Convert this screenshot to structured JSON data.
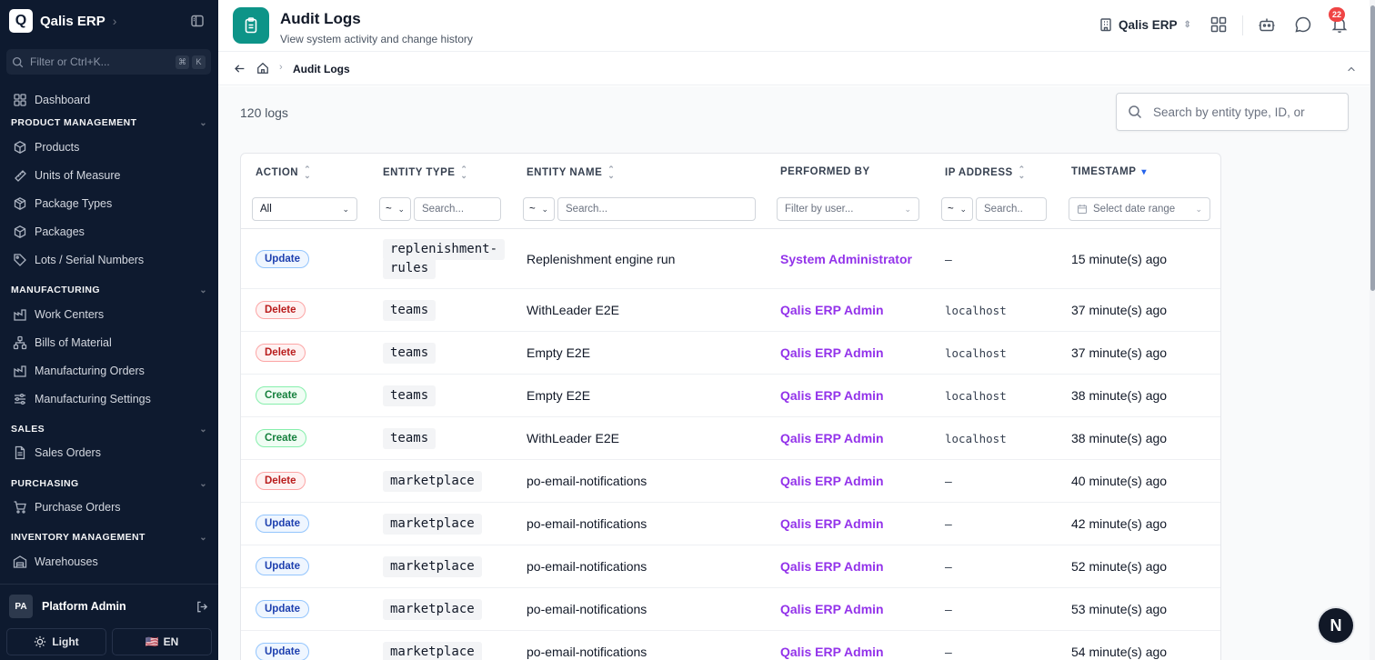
{
  "app": {
    "logo_letter": "Q",
    "name": "Qalis ERP"
  },
  "sidebar": {
    "filter_placeholder": "Filter or Ctrl+K...",
    "kbd1": "⌘",
    "kbd2": "K",
    "dashboard": "Dashboard",
    "sections": {
      "product": "PRODUCT MANAGEMENT",
      "manufacturing": "MANUFACTURING",
      "sales": "SALES",
      "purchasing": "PURCHASING",
      "inventory": "INVENTORY MANAGEMENT"
    },
    "items": {
      "products": "Products",
      "uom": "Units of Measure",
      "package_types": "Package Types",
      "packages": "Packages",
      "lots": "Lots / Serial Numbers",
      "work_centers": "Work Centers",
      "bom": "Bills of Material",
      "mfg_orders": "Manufacturing Orders",
      "mfg_settings": "Manufacturing Settings",
      "sales_orders": "Sales Orders",
      "purchase_orders": "Purchase Orders",
      "warehouses": "Warehouses"
    },
    "user": {
      "initials": "PA",
      "name": "Platform Admin"
    },
    "theme_label": "Light",
    "lang_flag": "🇺🇸",
    "lang_label": "EN"
  },
  "header": {
    "title": "Audit Logs",
    "subtitle": "View system activity and change history",
    "company": "Qalis ERP",
    "notification_count": "22"
  },
  "breadcrumb": {
    "current": "Audit Logs"
  },
  "main": {
    "log_count": "120 logs",
    "search_placeholder": "Search by entity type, ID, or"
  },
  "table": {
    "columns": {
      "action": "ACTION",
      "entity_type": "ENTITY TYPE",
      "entity_name": "ENTITY NAME",
      "performed_by": "PERFORMED BY",
      "ip_address": "IP ADDRESS",
      "timestamp": "TIMESTAMP"
    },
    "filters": {
      "action": "All",
      "op": "~",
      "search": "Search...",
      "search_short": "Search..",
      "user": "Filter by user...",
      "date": "Select date range"
    },
    "rows": [
      {
        "action": "Update",
        "entity_type_1": "replenishment-",
        "entity_type_2": "rules",
        "entity_name": "Replenishment engine run",
        "performed_by": "System Administrator",
        "ip": "–",
        "timestamp": "15 minute(s) ago"
      },
      {
        "action": "Delete",
        "entity_type": "teams",
        "entity_name": "WithLeader E2E",
        "performed_by": "Qalis ERP Admin",
        "ip": "localhost",
        "timestamp": "37 minute(s) ago"
      },
      {
        "action": "Delete",
        "entity_type": "teams",
        "entity_name": "Empty E2E",
        "performed_by": "Qalis ERP Admin",
        "ip": "localhost",
        "timestamp": "37 minute(s) ago"
      },
      {
        "action": "Create",
        "entity_type": "teams",
        "entity_name": "Empty E2E",
        "performed_by": "Qalis ERP Admin",
        "ip": "localhost",
        "timestamp": "38 minute(s) ago"
      },
      {
        "action": "Create",
        "entity_type": "teams",
        "entity_name": "WithLeader E2E",
        "performed_by": "Qalis ERP Admin",
        "ip": "localhost",
        "timestamp": "38 minute(s) ago"
      },
      {
        "action": "Delete",
        "entity_type": "marketplace",
        "entity_name": "po-email-notifications",
        "performed_by": "Qalis ERP Admin",
        "ip": "–",
        "timestamp": "40 minute(s) ago"
      },
      {
        "action": "Update",
        "entity_type": "marketplace",
        "entity_name": "po-email-notifications",
        "performed_by": "Qalis ERP Admin",
        "ip": "–",
        "timestamp": "42 minute(s) ago"
      },
      {
        "action": "Update",
        "entity_type": "marketplace",
        "entity_name": "po-email-notifications",
        "performed_by": "Qalis ERP Admin",
        "ip": "–",
        "timestamp": "52 minute(s) ago"
      },
      {
        "action": "Update",
        "entity_type": "marketplace",
        "entity_name": "po-email-notifications",
        "performed_by": "Qalis ERP Admin",
        "ip": "–",
        "timestamp": "53 minute(s) ago"
      },
      {
        "action": "Update",
        "entity_type": "marketplace",
        "entity_name": "po-email-notifications",
        "performed_by": "Qalis ERP Admin",
        "ip": "–",
        "timestamp": "54 minute(s) ago"
      }
    ]
  },
  "fab_letter": "N"
}
